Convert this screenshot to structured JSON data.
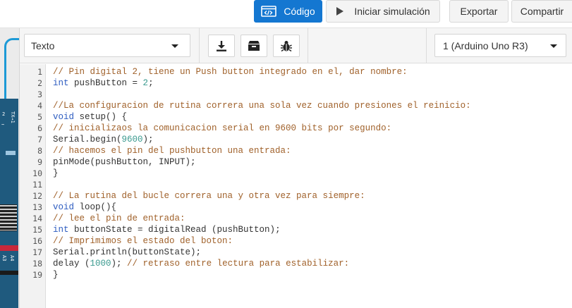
{
  "toolbar": {
    "code_label": "Código",
    "simulate_label": "Iniciar simulación",
    "export_label": "Exportar",
    "share_label": "Compartir"
  },
  "colors": {
    "code_button": "#1477d1",
    "comment": "#a0612a",
    "keyword": "#2d5cc0",
    "number": "#3a9a8f",
    "board": "#1f5a7e",
    "wire": "#1d9ad6"
  },
  "circuit": {
    "pin_labels": [
      "2",
      "TX→1",
      "~",
      "A3",
      "A4"
    ]
  },
  "editor_header": {
    "mode_value": "Texto",
    "device_value": "1 (Arduino Uno R3)",
    "icons": [
      "download-icon",
      "library-icon",
      "debug-bug-icon"
    ]
  },
  "code": {
    "line_numbers": [
      "1",
      "2",
      "3",
      "4",
      "5",
      "6",
      "7",
      "8",
      "9",
      "10",
      "11",
      "12",
      "13",
      "14",
      "15",
      "16",
      "17",
      "18",
      "19"
    ],
    "lines": [
      [
        {
          "t": "c",
          "v": "// Pin digital 2, tiene un Push button integrado en el, dar nombre:"
        }
      ],
      [
        {
          "t": "k",
          "v": "int"
        },
        {
          "t": "p",
          "v": " pushButton = "
        },
        {
          "t": "n",
          "v": "2"
        },
        {
          "t": "p",
          "v": ";"
        }
      ],
      [],
      [
        {
          "t": "c",
          "v": "//La configuracion de rutina correra una sola vez cuando presiones el reinicio:"
        }
      ],
      [
        {
          "t": "k",
          "v": "void"
        },
        {
          "t": "p",
          "v": " setup() {"
        }
      ],
      [
        {
          "t": "c",
          "v": "// inicializaos la comunicacion serial en 9600 bits por segundo:"
        }
      ],
      [
        {
          "t": "p",
          "v": "Serial.begin("
        },
        {
          "t": "n",
          "v": "9600"
        },
        {
          "t": "p",
          "v": ");"
        }
      ],
      [
        {
          "t": "c",
          "v": "// hacemos el pin del pushbutton una entrada:"
        }
      ],
      [
        {
          "t": "p",
          "v": "pinMode(pushButton, INPUT);"
        }
      ],
      [
        {
          "t": "p",
          "v": "}"
        }
      ],
      [],
      [
        {
          "t": "c",
          "v": "// La rutina del bucle correra una y otra vez para siempre:"
        }
      ],
      [
        {
          "t": "k",
          "v": "void"
        },
        {
          "t": "p",
          "v": " loop(){"
        }
      ],
      [
        {
          "t": "c",
          "v": "// lee el pin de entrada:"
        }
      ],
      [
        {
          "t": "k",
          "v": "int"
        },
        {
          "t": "p",
          "v": " buttonState = digitalRead (pushButton);"
        }
      ],
      [
        {
          "t": "c",
          "v": "// Imprimimos el estado del boton:"
        }
      ],
      [
        {
          "t": "p",
          "v": "Serial.println(buttonState);"
        }
      ],
      [
        {
          "t": "p",
          "v": "delay ("
        },
        {
          "t": "n",
          "v": "1000"
        },
        {
          "t": "p",
          "v": "); "
        },
        {
          "t": "c",
          "v": "// retraso entre lectura para estabilizar:"
        }
      ],
      [
        {
          "t": "p",
          "v": "}"
        }
      ]
    ]
  }
}
